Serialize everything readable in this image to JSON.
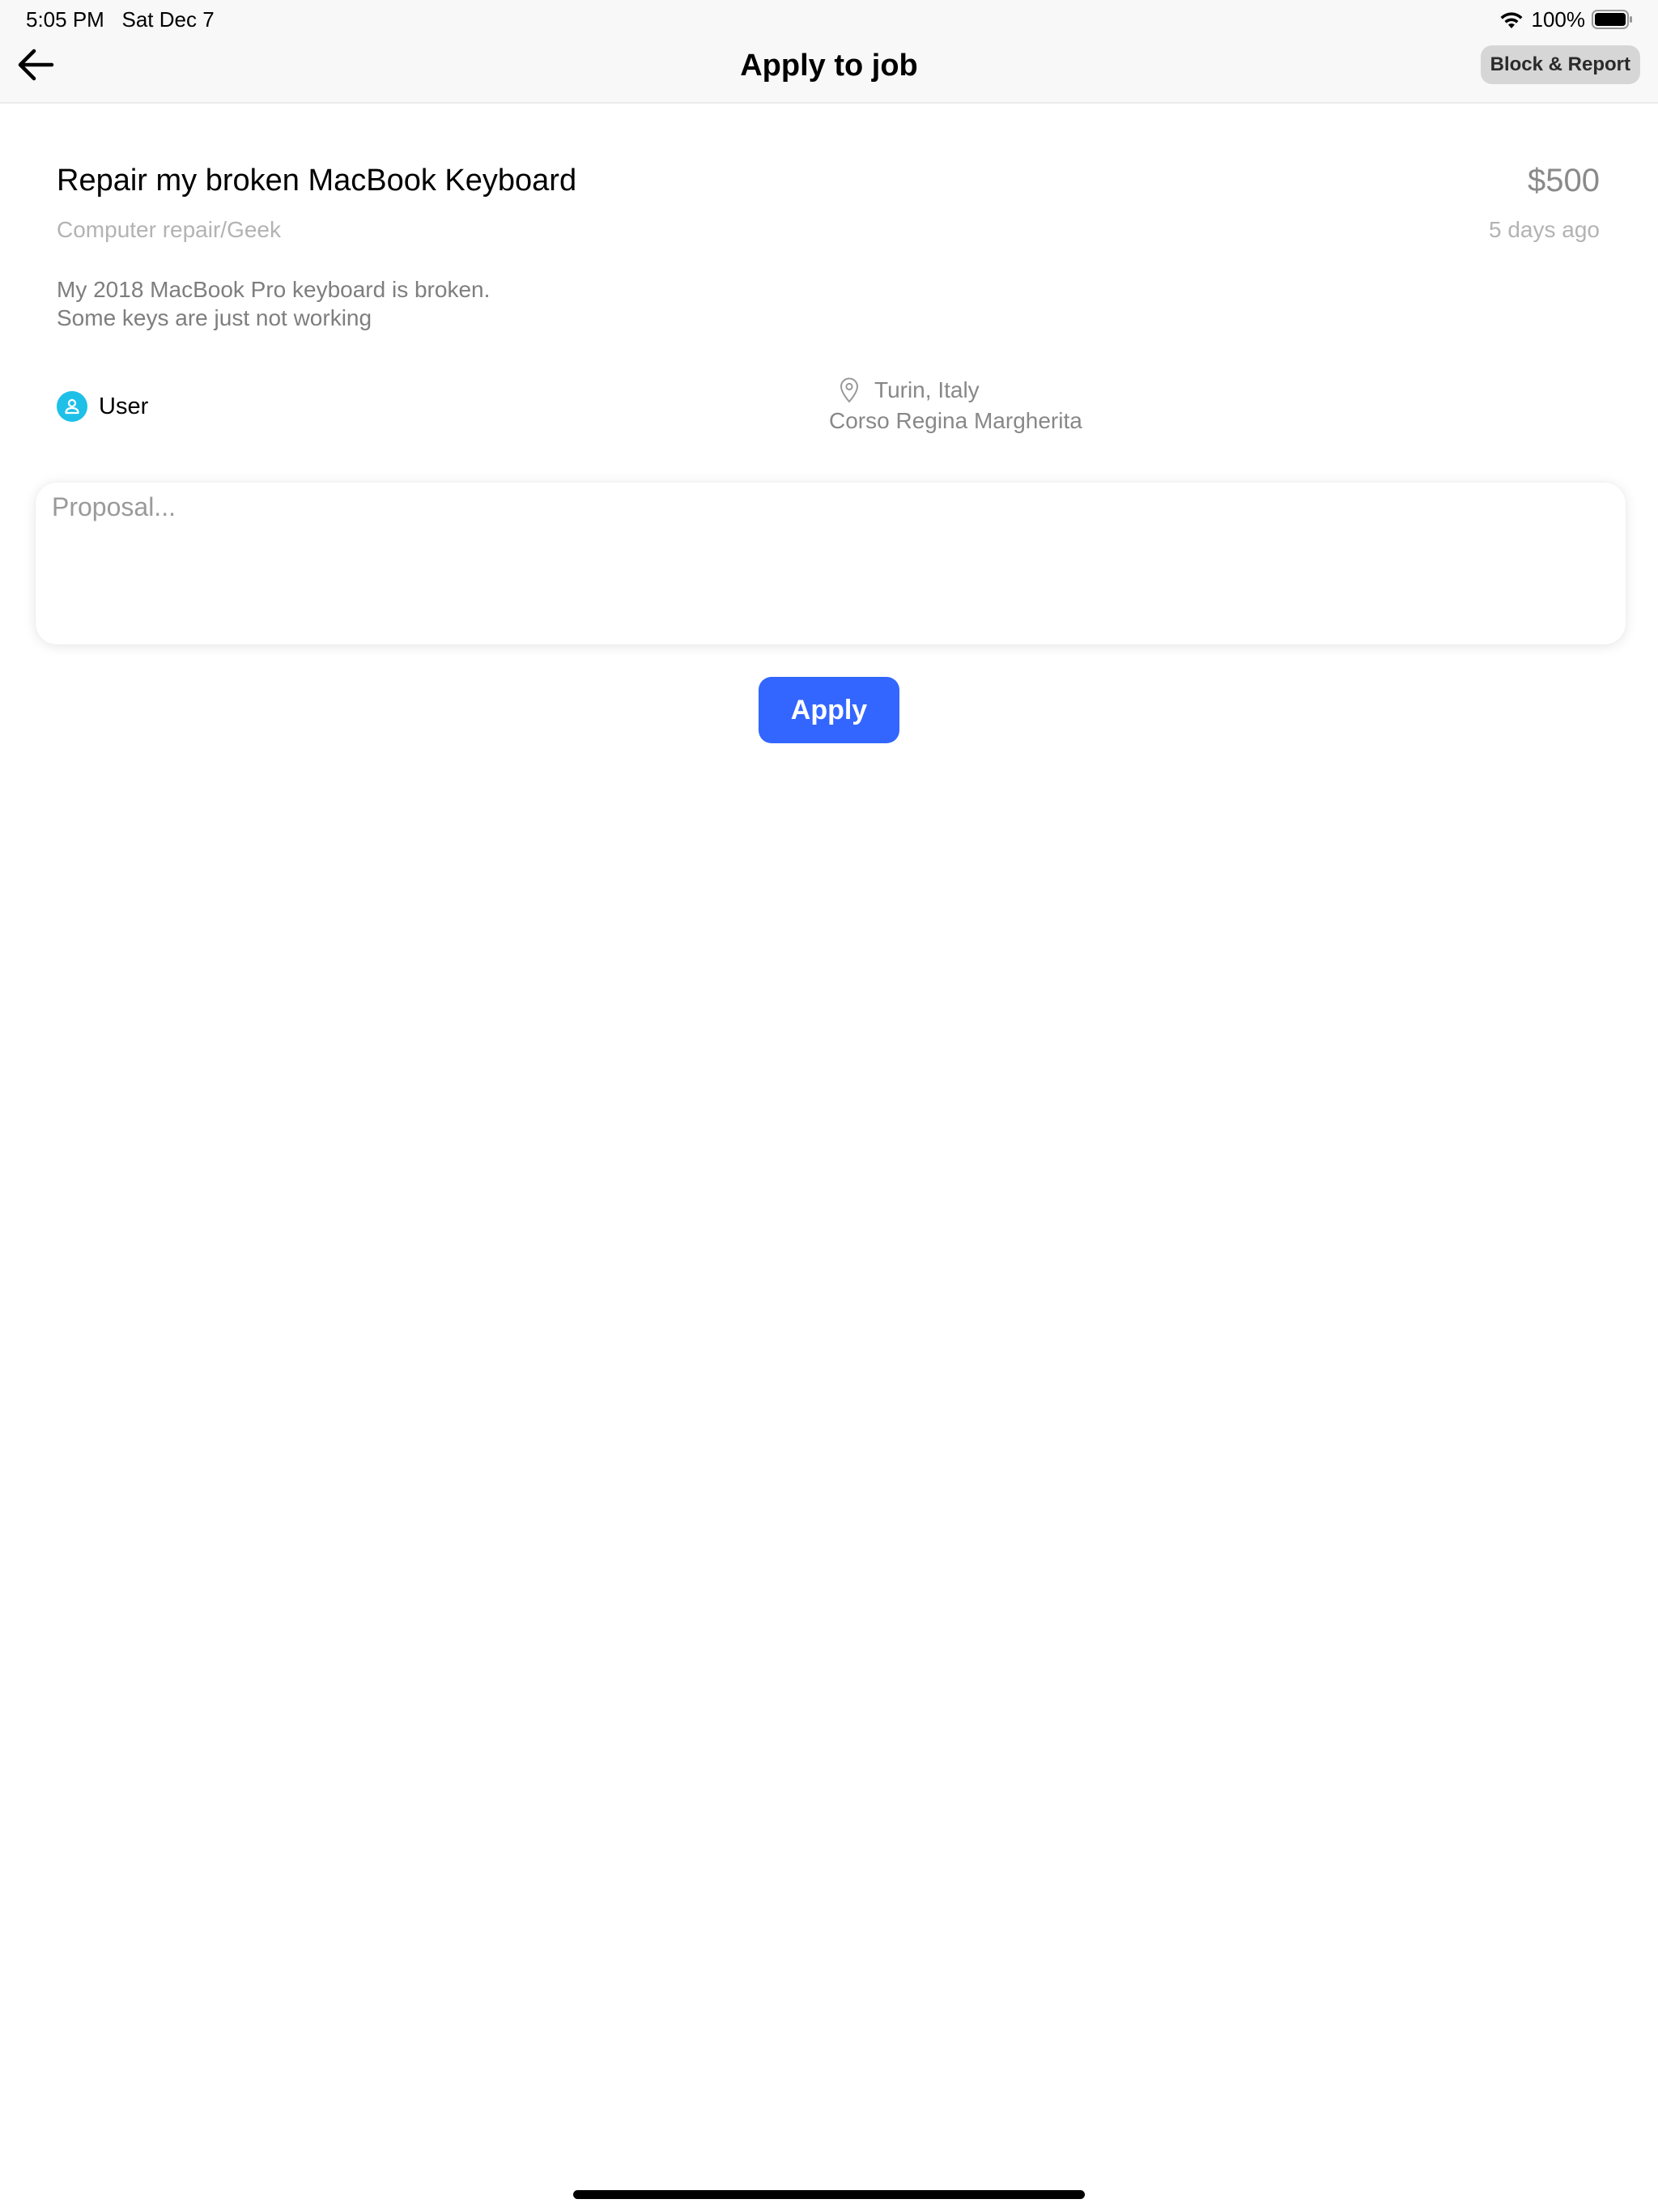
{
  "status_bar": {
    "time": "5:05 PM",
    "date": "Sat Dec 7",
    "battery": "100%",
    "icons": [
      "wifi-icon",
      "battery-icon"
    ]
  },
  "nav": {
    "back_icon": "arrow-left-icon",
    "title": "Apply to job",
    "block_report_label": "Block & Report"
  },
  "job": {
    "title": "Repair my broken MacBook Keyboard",
    "price": "$500",
    "category": "Computer repair/Geek",
    "posted": "5 days ago",
    "description_lines": [
      "My 2018 MacBook Pro keyboard is broken.",
      "Some keys are just not working"
    ]
  },
  "user": {
    "icon": "user-icon",
    "name": "User",
    "avatar_color": "#1ec0e8"
  },
  "location": {
    "icon": "location-pin-icon",
    "city": "Turin, Italy",
    "street": "Corso Regina Margherita"
  },
  "proposal": {
    "placeholder": "Proposal...",
    "value": ""
  },
  "apply_button": {
    "label": "Apply",
    "color": "#3366ff"
  }
}
